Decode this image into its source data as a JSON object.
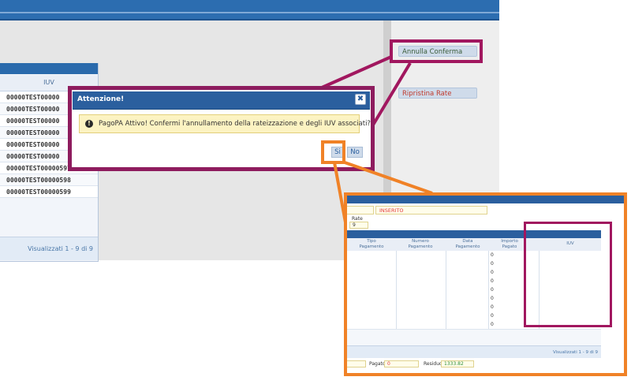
{
  "background": {
    "grid": {
      "column_header": "IUV",
      "rows": [
        "00000TEST00000",
        "00000TEST00000",
        "00000TEST00000",
        "00000TEST00000",
        "00000TEST00000",
        "00000TEST00000",
        "00000TEST00000597",
        "00000TEST00000598",
        "00000TEST00000599"
      ],
      "footer": "Visualizzati 1 - 9 di 9"
    },
    "buttons": {
      "annulla": "Annulla Conferma",
      "ripristina": "Ripristina Rate"
    }
  },
  "dialog": {
    "title": "Attenzione!",
    "close_glyph": "✖",
    "icon_glyph": "!",
    "message": "PagoPA Attivo! Confermi l'annullamento della rateizzazione e degli IUV associati?",
    "yes_label": "Si",
    "no_label": "No"
  },
  "zoom": {
    "stato_value": "INSERITO",
    "rate_label": "Rate",
    "rate_value": "9",
    "columns": {
      "tipo": "Tipo\nPagamento",
      "numero": "Numero\nPagamento",
      "data": "Data\nPagamento",
      "importo": "Importo\nPagato",
      "iuv": "IUV"
    },
    "importo_values": [
      "0",
      "0",
      "0",
      "0",
      "0",
      "0",
      "0",
      "0",
      "0"
    ],
    "footer": "Visualizzati 1 - 9 di 9",
    "pagato_label": "Pagato",
    "pagato_value": "0",
    "residuo_label": "Residuo",
    "residuo_value": "1333.82"
  },
  "colors": {
    "annotation_purple": "#a1175f",
    "annotation_orange": "#f08227",
    "title_blue": "#2b5f9e"
  }
}
